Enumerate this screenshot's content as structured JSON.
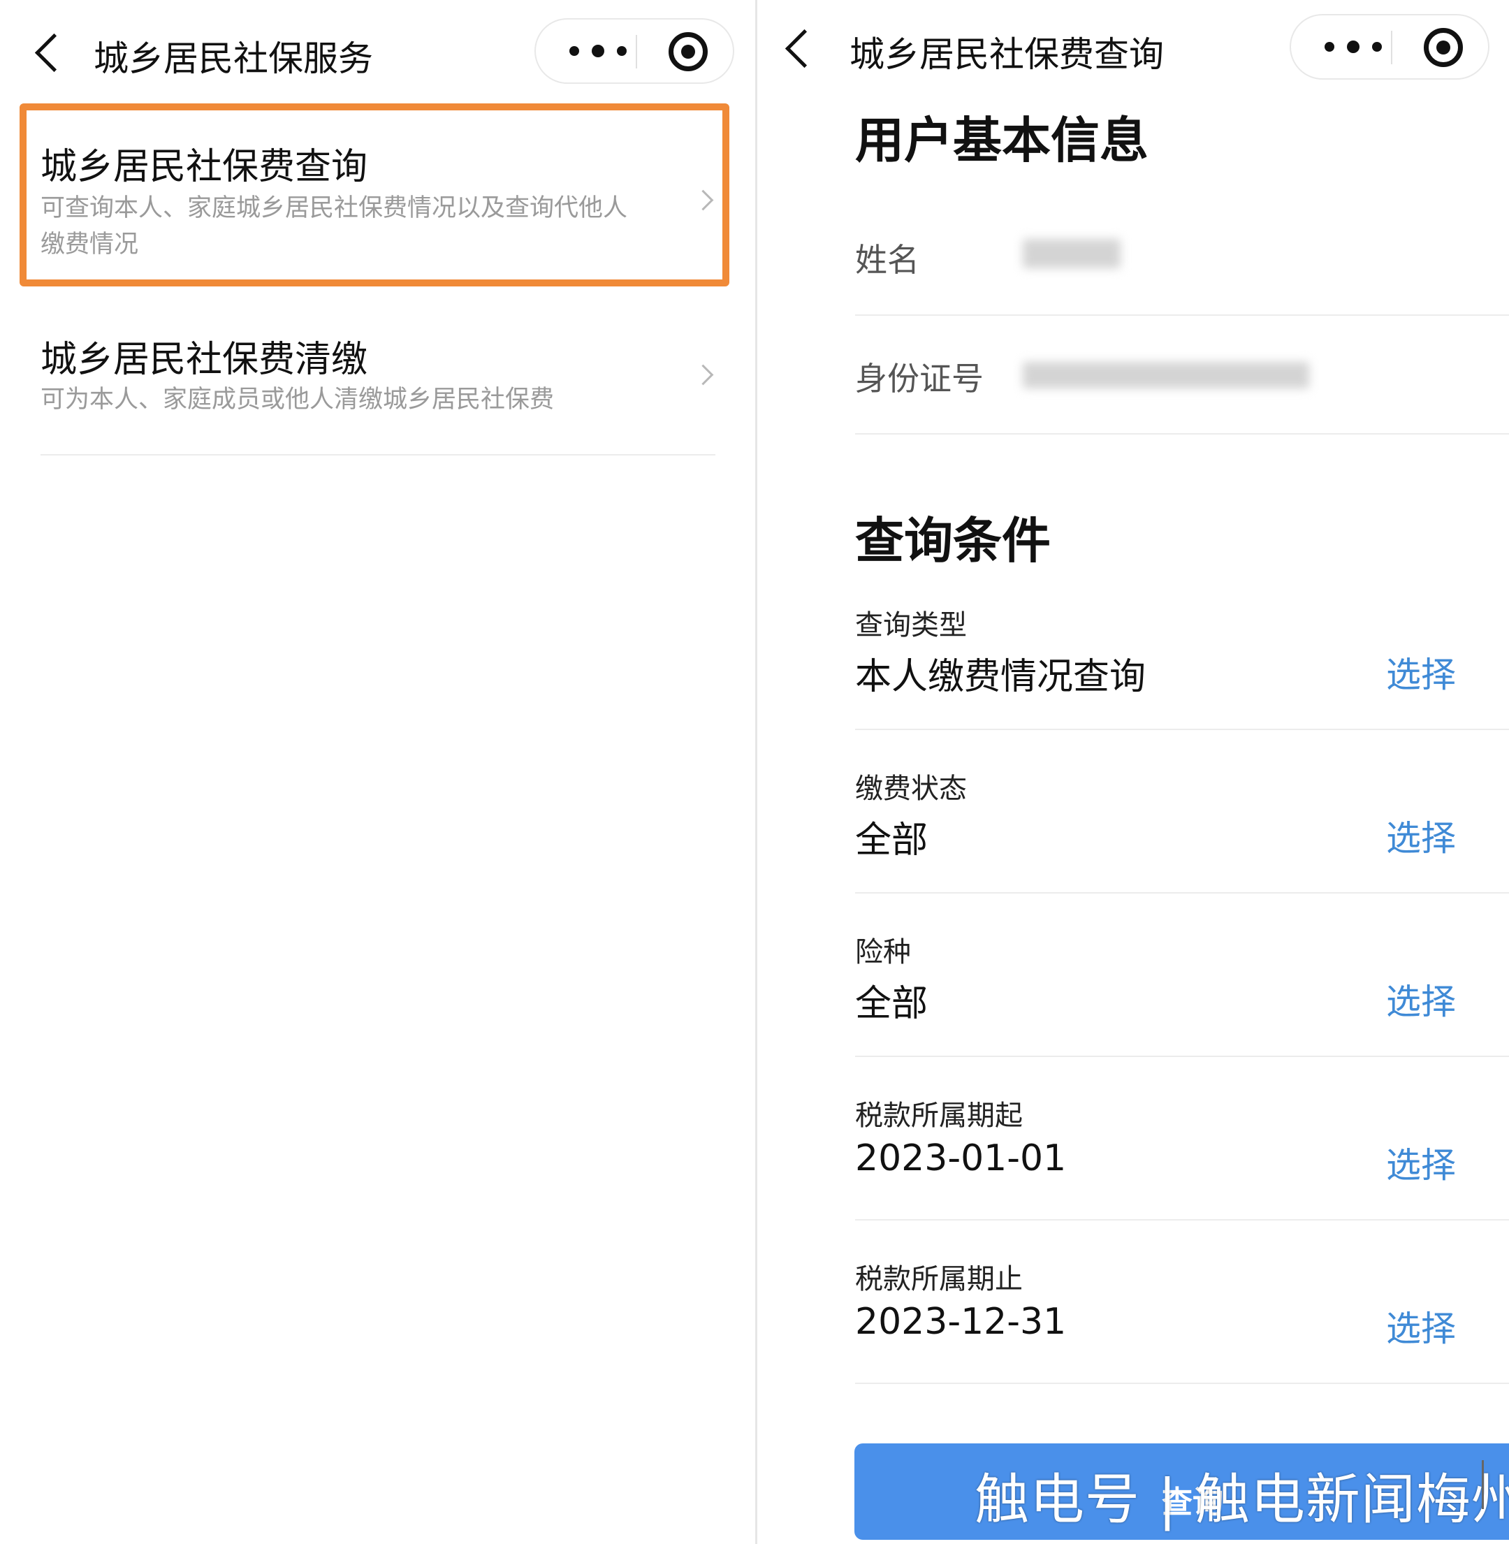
{
  "left": {
    "nav": {
      "title": "城乡居民社保服务"
    },
    "items": [
      {
        "title": "城乡居民社保费查询",
        "desc": "可查询本人、家庭城乡居民社保费情况以及查询代他人缴费情况",
        "highlighted": true
      },
      {
        "title": "城乡居民社保费清缴",
        "desc": "可为本人、家庭成员或他人清缴城乡居民社保费"
      }
    ]
  },
  "right": {
    "nav": {
      "title": "城乡居民社保费查询"
    },
    "user_info": {
      "heading": "用户基本信息",
      "name_label": "姓名",
      "id_label": "身份证号"
    },
    "conditions": {
      "heading": "查询条件",
      "fields": [
        {
          "label": "查询类型",
          "value": "本人缴费情况查询",
          "action": "选择"
        },
        {
          "label": "缴费状态",
          "value": "全部",
          "action": "选择"
        },
        {
          "label": "险种",
          "value": "全部",
          "action": "选择"
        },
        {
          "label": "税款所属期起",
          "value": "2023-01-01",
          "action": "选择"
        },
        {
          "label": "税款所属期止",
          "value": "2023-12-31",
          "action": "选择"
        }
      ]
    },
    "query_button": "查询"
  },
  "watermark": "触电号 | 触电新闻梅州",
  "colors": {
    "highlight": "#f08a38",
    "link": "#3f8ad6",
    "button": "#4a90ea"
  }
}
